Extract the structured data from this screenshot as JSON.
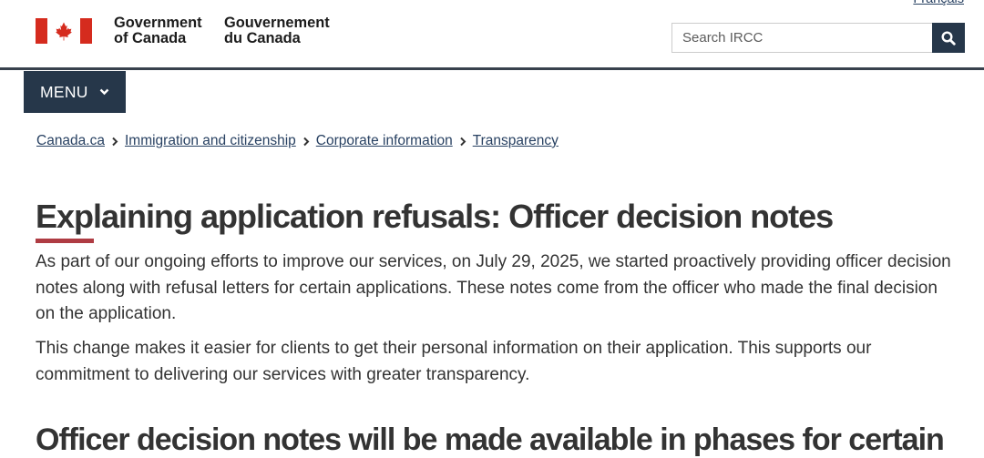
{
  "language_toggle": {
    "label": "Français"
  },
  "brand": {
    "flag_icon": "canada-flag-icon",
    "name_en_line1": "Government",
    "name_en_line2": "of Canada",
    "name_fr_line1": "Gouvernement",
    "name_fr_line2": "du Canada"
  },
  "search": {
    "placeholder": "Search IRCC",
    "value": "",
    "button_icon": "search-icon"
  },
  "menu": {
    "label": "MENU",
    "icon": "chevron-down-icon"
  },
  "breadcrumb_separator_icon": "chevron-right-icon",
  "breadcrumb": [
    {
      "label": "Canada.ca"
    },
    {
      "label": "Immigration and citizenship"
    },
    {
      "label": "Corporate information"
    },
    {
      "label": "Transparency"
    }
  ],
  "main": {
    "title": "Explaining application refusals: Officer decision notes",
    "paragraphs": [
      "As part of our ongoing efforts to improve our services, on July 29, 2025, we started proactively providing officer decision notes along with refusal letters for certain applications. These notes come from the officer who made the final decision on the application.",
      "This change makes it easier for clients to get their personal information on their application. This supports our commitment to delivering our services with greater transparency."
    ],
    "section_heading": "Officer decision notes will be made available in phases for certain"
  },
  "colors": {
    "brand_navy": "#26374a",
    "accent_red": "#af3c43",
    "link_blue": "#284162",
    "flag_red": "#d52b1e",
    "header_rule": "#38414d"
  }
}
